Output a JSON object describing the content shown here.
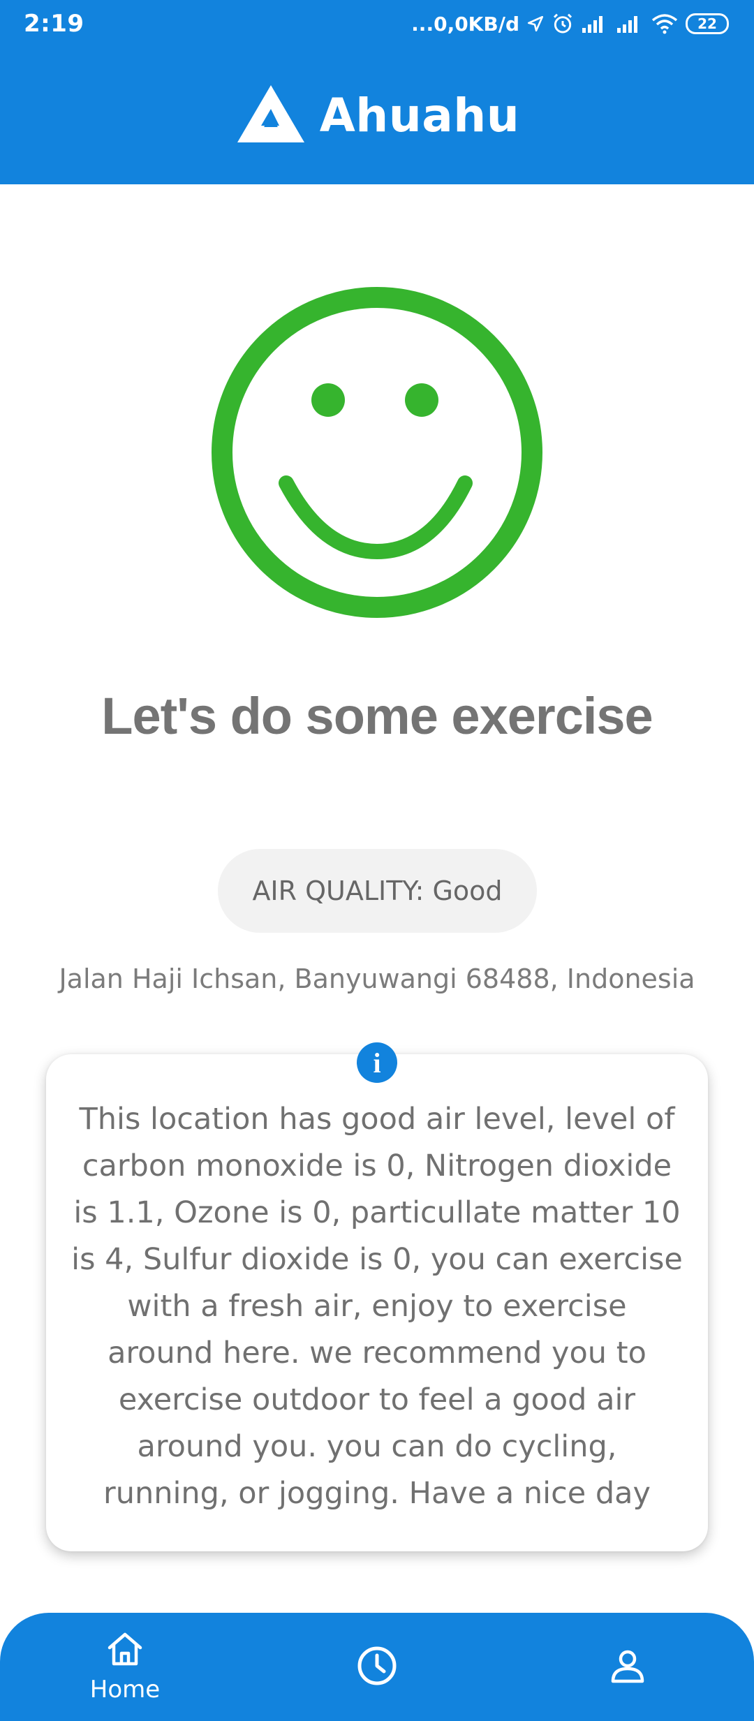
{
  "status_bar": {
    "time": "2:19",
    "network_speed": "...0,0KB/d",
    "battery": "22"
  },
  "app": {
    "name": "Ahuahu",
    "brand_color": "#1283DD"
  },
  "status": {
    "face_icon": "smiley-face-icon",
    "face_color": "#36B42E",
    "headline": "Let's do some exercise",
    "air_quality_label": "AIR QUALITY: Good",
    "address": "Jalan Haji Ichsan, Banyuwangi 68488, Indonesia"
  },
  "info": {
    "icon": "info-icon",
    "text": "This location has good air level, level of carbon monoxide is 0, Nitrogen dioxide is 1.1, Ozone is 0, particullate matter 10 is 4, Sulfur dioxide is 0, you can exercise with a fresh air, enjoy to exercise around here. we recommend you to exercise outdoor to feel a good air around you. you can do cycling, running, or jogging. Have a nice day"
  },
  "bottom_nav": {
    "home_label": "Home",
    "items": [
      "home-icon",
      "clock-icon",
      "person-icon"
    ]
  }
}
